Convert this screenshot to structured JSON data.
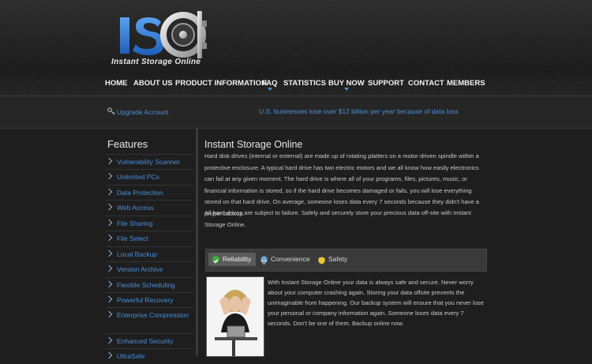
{
  "logo": {
    "text": "Instant Storage Online",
    "letters": "IS",
    "colors": {
      "blue": "#2f7de1",
      "silver": "#c9c9c9"
    }
  },
  "nav": {
    "items": [
      {
        "label": "HOME",
        "has_dropdown": false
      },
      {
        "label": "ABOUT US",
        "has_dropdown": false
      },
      {
        "label": "PRODUCT INFORMATION",
        "has_dropdown": false
      },
      {
        "label": "FAQ",
        "has_dropdown": true
      },
      {
        "label": "STATISTICS",
        "has_dropdown": false
      },
      {
        "label": "BUY NOW",
        "has_dropdown": true
      },
      {
        "label": "SUPPORT",
        "has_dropdown": false
      },
      {
        "label": "CONTACT",
        "has_dropdown": false
      },
      {
        "label": "MEMBERS",
        "has_dropdown": false
      }
    ]
  },
  "subbar": {
    "upgrade_label": "Upgrade Account",
    "upgrade_icon": "key-icon",
    "ticker": "U.S. businesses lose over $12 billion per year because of data loss"
  },
  "sidebar": {
    "title": "Features",
    "items": [
      "Vulnerability Scanner",
      "Unlimited PCs",
      "Data Protection",
      "Web Access",
      "File Sharing",
      "File Select",
      "Local Backup",
      "Version Archive",
      "Flexible Scheduling",
      "Powerful Recovery",
      "Enterprise Compression",
      "Enhanced Security",
      "UltraSafe"
    ]
  },
  "main": {
    "title": "Instant Storage Online",
    "paragraph1": "Hard disk drives (internal or external) are made up of rotating platters on a motor-driven spindle within a protective enclosure. A typical hard drive has two electric motors and we all know how easily electronics can fail at any given moment. The hard drive is where all of your programs, files, pictures, music, or financial information is stored, so if the hard drive becomes damaged or fails, you will lose everything stored on that hard drive. On average, someone loses data every 7 seconds because they didn't have a proper backup.",
    "paragraph2": "All hard drives are subject to failure. Safely and securely store your precious data off-site with Instant Storage Online.",
    "tabs": [
      {
        "label": "Reliability",
        "icon": "check-icon",
        "active": true
      },
      {
        "label": "Convenience",
        "icon": "globe-icon",
        "active": false
      },
      {
        "label": "Safety",
        "icon": "shield-icon",
        "active": false
      }
    ],
    "tab_content": "With Instant Storage Online your data is always safe and secure. Never worry about your computer crashing again. Storing your data offsite prevents the unimaginable from happening. Our backup system will ensure that you never lose your personal or company information again. Someone loses data every 7 seconds. Don't be one of them. Backup online now."
  },
  "colors": {
    "link": "#4a8fd8",
    "background": "#1e1e1e",
    "text": "#c8c8c8"
  }
}
